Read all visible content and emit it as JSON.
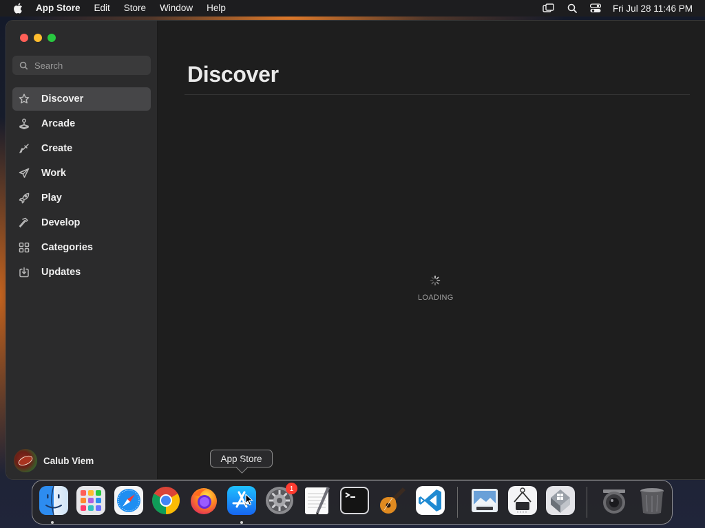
{
  "menubar": {
    "app_name": "App Store",
    "menus": [
      "Edit",
      "Store",
      "Window",
      "Help"
    ],
    "clock": "Fri Jul 28  11:46 PM"
  },
  "sidebar": {
    "search_placeholder": "Search",
    "items": [
      {
        "label": "Discover",
        "icon": "star-icon",
        "active": true
      },
      {
        "label": "Arcade",
        "icon": "joystick-icon",
        "active": false
      },
      {
        "label": "Create",
        "icon": "brush-icon",
        "active": false
      },
      {
        "label": "Work",
        "icon": "paper-plane-icon",
        "active": false
      },
      {
        "label": "Play",
        "icon": "rocket-icon",
        "active": false
      },
      {
        "label": "Develop",
        "icon": "hammer-icon",
        "active": false
      },
      {
        "label": "Categories",
        "icon": "grid-icon",
        "active": false
      },
      {
        "label": "Updates",
        "icon": "download-icon",
        "active": false
      }
    ],
    "user_name": "Calub Viem"
  },
  "main": {
    "title": "Discover",
    "loading_text": "LOADING"
  },
  "tooltip": {
    "text": "App Store"
  },
  "dock": {
    "apps": [
      {
        "name": "Finder",
        "icon": "finder-icon",
        "running": true
      },
      {
        "name": "Launchpad",
        "icon": "launchpad-icon",
        "running": false
      },
      {
        "name": "Safari",
        "icon": "safari-icon",
        "running": false
      },
      {
        "name": "Google Chrome",
        "icon": "chrome-icon",
        "running": false
      },
      {
        "name": "Firefox",
        "icon": "firefox-icon",
        "running": false
      },
      {
        "name": "App Store",
        "icon": "app-store-icon",
        "running": true
      },
      {
        "name": "System Settings",
        "icon": "settings-icon",
        "running": false,
        "badge": "1"
      },
      {
        "name": "TextEdit",
        "icon": "textedit-icon",
        "running": false
      },
      {
        "name": "Terminal",
        "icon": "terminal-icon",
        "running": false
      },
      {
        "name": "GarageBand",
        "icon": "guitar-icon",
        "running": false
      },
      {
        "name": "Visual Studio Code",
        "icon": "vscode-icon",
        "running": false
      },
      {
        "name": "Preview",
        "icon": "preview-icon",
        "running": false
      },
      {
        "name": "System Information",
        "icon": "system-info-icon",
        "running": false
      },
      {
        "name": "Boot Camp Assistant",
        "icon": "bootcamp-icon",
        "running": false
      },
      {
        "name": "Screenshot",
        "icon": "screenshot-icon",
        "running": false
      },
      {
        "name": "Trash",
        "icon": "trash-icon",
        "running": false
      }
    ]
  },
  "colors": {
    "sidebar_bg": "#2b2b2c",
    "main_bg": "#1e1e1e",
    "active_item": "#464648",
    "badge": "#ff3b30"
  }
}
